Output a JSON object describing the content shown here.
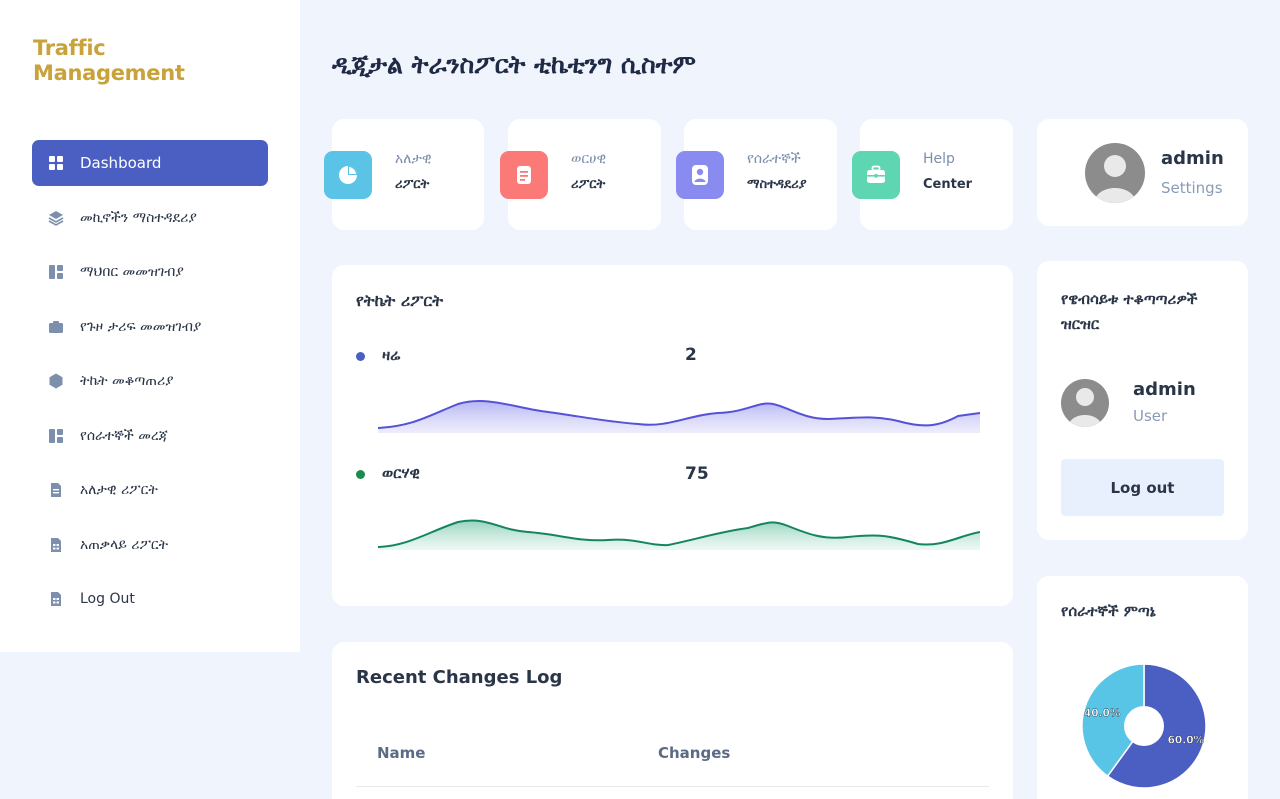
{
  "brand": {
    "line1": "Traffic",
    "line2": "Management"
  },
  "colors": {
    "accent": "#4a5fc1",
    "brand": "#c9a23a",
    "background": "#eff4fd",
    "today_series": "#5452d6",
    "month_series": "#16855f"
  },
  "sidebar": {
    "items": [
      {
        "label": "Dashboard",
        "icon": "grid-icon",
        "active": true
      },
      {
        "label": "መኪኖችን ማስተዳደሪያ",
        "icon": "layers-icon"
      },
      {
        "label": "ማህበር መመዝገብያ",
        "icon": "layout-icon"
      },
      {
        "label": "የጉዞ ታሪፍ መመዝገብያ",
        "icon": "folder-icon"
      },
      {
        "label": "ትኬት መቆጣጠሪያ",
        "icon": "hexagon-icon"
      },
      {
        "label": "የሰራተኞች መረጃ",
        "icon": "layout-icon"
      },
      {
        "label": "አለታዊ ሪፖርት",
        "icon": "file-icon"
      },
      {
        "label": "አጠቃላይ ሪፖርት",
        "icon": "table-icon"
      },
      {
        "label": "Log Out",
        "icon": "table-icon"
      }
    ]
  },
  "header": {
    "title": "ዲጂታል ትራንስፖርት ቲኬቲንግ ሲስተም"
  },
  "tiles": [
    {
      "line1": "አለታዊ",
      "line2": "ሪፖርት",
      "icon": "pie-chart-icon",
      "color": "#5bc4e6"
    },
    {
      "line1": "ወርሀዊ",
      "line2": "ሪፖርት",
      "icon": "document-icon",
      "color": "#fb7a78"
    },
    {
      "line1": "የሰራተኞች",
      "line2": "ማስተዳደሪያ",
      "icon": "user-icon",
      "color": "#8a8bf0"
    },
    {
      "line1": "Help",
      "line2": "Center",
      "icon": "briefcase-icon",
      "color": "#5dd6b1"
    }
  ],
  "profile": {
    "name": "admin",
    "link": "Settings"
  },
  "ticket_report": {
    "title": "የትኬት ሪፖርት",
    "series": [
      {
        "label": "ዛሬ",
        "value": "2",
        "color": "#5452d6"
      },
      {
        "label": "ወርሃዊ",
        "value": "75",
        "color": "#16855f"
      }
    ]
  },
  "monitors": {
    "title_line1": "የዌብሳይቱ ተቆጣጣሪዎች",
    "title_line2": "ዝርዝር",
    "user_name": "admin",
    "user_role": "User",
    "logout_label": "Log out"
  },
  "changes_log": {
    "title": "Recent Changes Log",
    "columns": [
      "Name",
      "Changes"
    ]
  },
  "staff_ratio": {
    "title": "የሰራተኞች ምጣኔ"
  },
  "chart_data": {
    "type": "pie",
    "title": "የሰራተኞች ምጣኔ",
    "slices": [
      {
        "label": "60.0%",
        "value": 60.0,
        "color": "#4a5fc1"
      },
      {
        "label": "40.0%",
        "value": 40.0,
        "color": "#58c4e6"
      }
    ]
  }
}
